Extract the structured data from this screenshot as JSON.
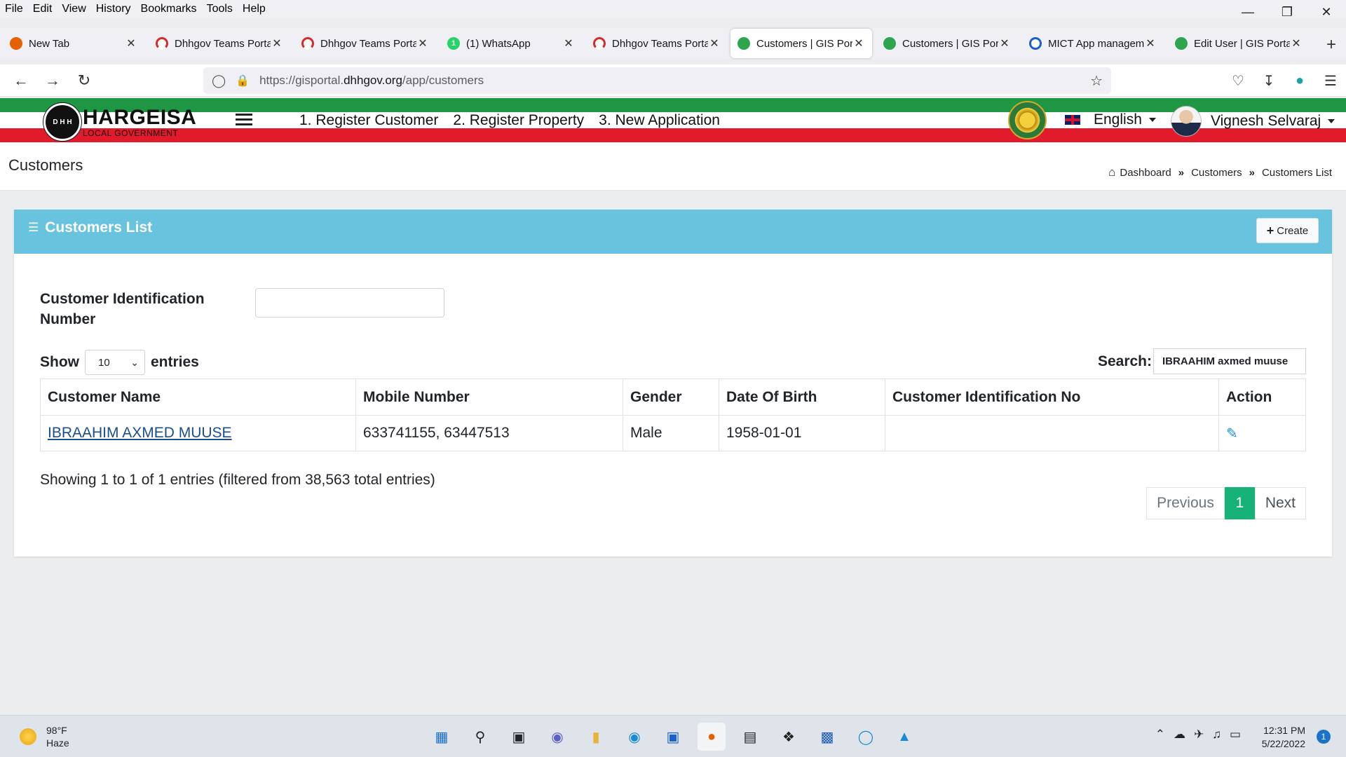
{
  "browser": {
    "menu": [
      "File",
      "Edit",
      "View",
      "History",
      "Bookmarks",
      "Tools",
      "Help"
    ],
    "tabs": [
      {
        "title": "New Tab",
        "color": "#e66000"
      },
      {
        "title": "Dhhgov Teams Portal",
        "color": "#d62a2a"
      },
      {
        "title": "Dhhgov Teams Portal",
        "color": "#d62a2a"
      },
      {
        "title": "(1) WhatsApp",
        "color": "#25d366"
      },
      {
        "title": "Dhhgov Teams Portal",
        "color": "#d62a2a"
      },
      {
        "title": "Customers | GIS Portal",
        "color": "#2ea44f"
      },
      {
        "title": "Customers | GIS Portal",
        "color": "#2ea44f"
      },
      {
        "title": "MICT App management",
        "color": "#1a5fd0"
      },
      {
        "title": "Edit User | GIS Portal",
        "color": "#2ea44f"
      }
    ],
    "url_prefix": "https://gisportal.",
    "url_domain": "dhhgov.org",
    "url_path": "/app/customers"
  },
  "app": {
    "logo_title": "HARGEISA",
    "logo_subtitle": "LOCAL GOVERNMENT",
    "logo_mark": "D H H",
    "nav": [
      "1. Register Customer",
      "2. Register Property",
      "3. New Application"
    ],
    "language": "English",
    "user": "Vignesh Selvaraj"
  },
  "page": {
    "title": "Customers",
    "breadcrumb": [
      "Dashboard",
      "Customers",
      "Customers List"
    ]
  },
  "card": {
    "title": "Customers List",
    "create_label": "Create",
    "cin_label_1": "Customer Identification",
    "cin_label_2": "Number",
    "show_label": "Show",
    "entries_value": "10",
    "entries_label": "entries",
    "search_label": "Search:",
    "search_value": "IBRAAHIM axmed muuse",
    "columns": [
      "Customer Name",
      "Mobile Number",
      "Gender",
      "Date Of Birth",
      "Customer Identification No",
      "Action"
    ],
    "rows": [
      {
        "name": "IBRAAHIM AXMED MUUSE",
        "mobile": "633741155, 63447513",
        "gender": "Male",
        "dob": "1958-01-01",
        "cin": ""
      }
    ],
    "info": "Showing 1 to 1 of 1 entries (filtered from 38,563 total entries)",
    "pager": {
      "prev": "Previous",
      "current": "1",
      "next": "Next"
    }
  },
  "taskbar": {
    "temp": "98°F",
    "condition": "Haze",
    "time": "12:31 PM",
    "date": "5/22/2022",
    "notifications": "1"
  }
}
